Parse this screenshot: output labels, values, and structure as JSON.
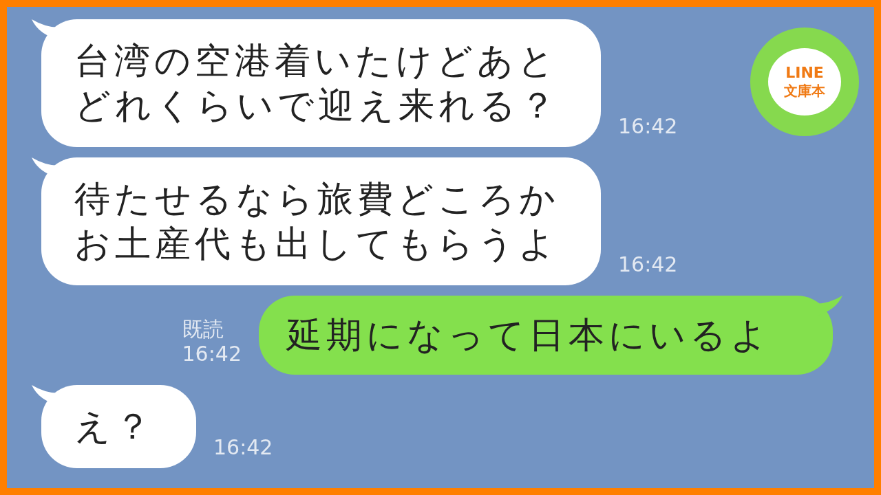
{
  "logo": {
    "line1": "LINE",
    "line2": "文庫本"
  },
  "messages": [
    {
      "kind": "received",
      "text": "台湾の空港着いたけどあとどれくらいで迎え来れる？",
      "time": "16:42"
    },
    {
      "kind": "received",
      "text": "待たせるなら旅費どころかお土産代も出してもらうよ",
      "time": "16:42"
    },
    {
      "kind": "sent",
      "text": "延期になって日本にいるよ",
      "read": "既読",
      "time": "16:42"
    },
    {
      "kind": "received",
      "text": "え？",
      "time": "16:42"
    }
  ]
}
